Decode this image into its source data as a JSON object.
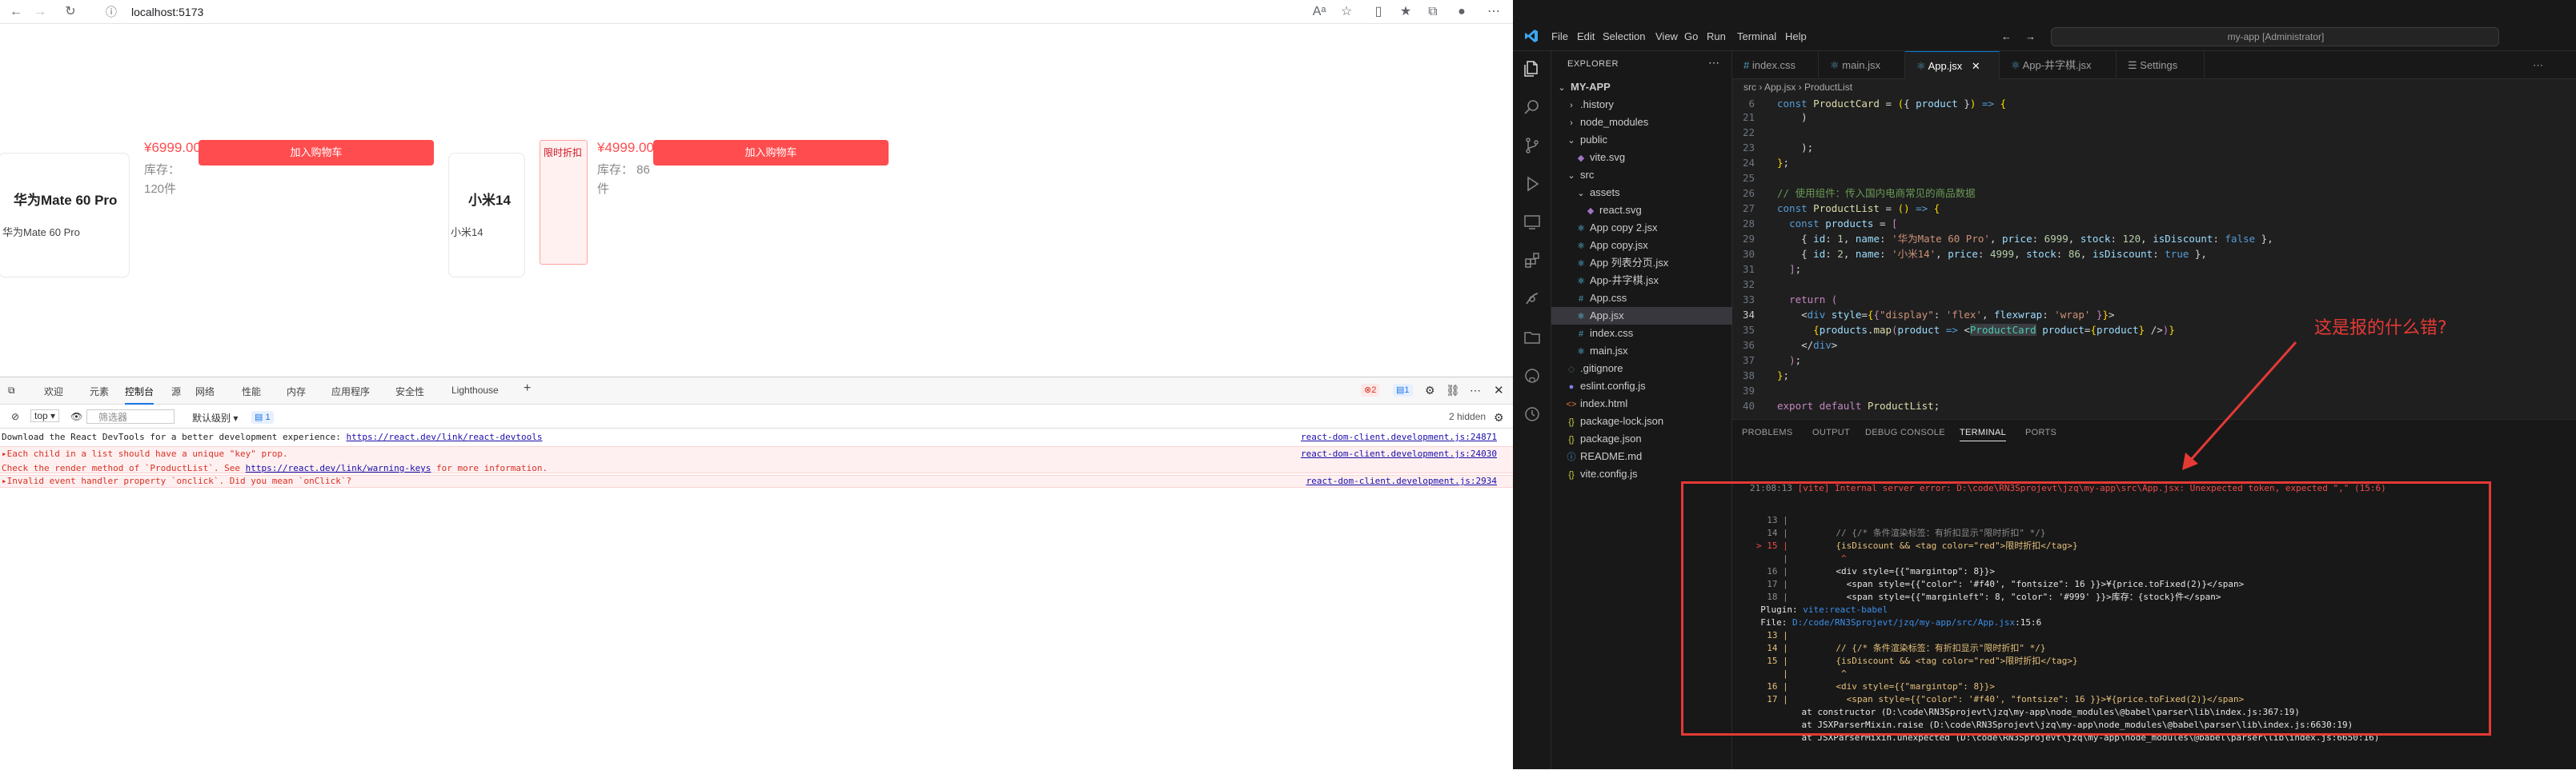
{
  "browser": {
    "url": "localhost:5173",
    "products": [
      {
        "name": "华为Mate 60 Pro",
        "img_alt": "华为Mate 60 Pro",
        "price": "¥6999.00",
        "stock": "库存：120件",
        "stock_l1": "库存：",
        "stock_l2": "120件",
        "button": "加入购物车",
        "tag": ""
      },
      {
        "name": "小米14",
        "img_alt": "小米14",
        "price": "¥4999.00",
        "stock_l1": "库存： 86",
        "stock_l2": "件",
        "button": "加入购物车",
        "tag": "限时折扣"
      }
    ]
  },
  "devtools": {
    "tabs": [
      "欢迎",
      "元素",
      "控制台",
      "源",
      "网络",
      "性能",
      "内存",
      "应用程序",
      "安全性",
      "Lighthouse"
    ],
    "active_tab": "控制台",
    "context": "top",
    "filter_placeholder": "筛选器",
    "level": "默认级别",
    "msg_badge": "1",
    "hidden": "2 hidden",
    "errors_badge": "2",
    "info_badge": "1",
    "lines": [
      {
        "type": "info",
        "text": "Download the React DevTools for a better development experience: ",
        "link": "https://react.dev/link/react-devtools",
        "src": "react-dom-client.development.js:24871"
      },
      {
        "type": "err",
        "text": "▸Each child in a list should have a unique \"key\" prop.",
        "src": "react-dom-client.development.js:24030"
      },
      {
        "type": "err",
        "text": "Check the render method of `ProductList`. See ",
        "link": "https://react.dev/link/warning-keys",
        "tail": " for more information.",
        "src": ""
      },
      {
        "type": "err",
        "text": "▸Invalid event handler property `onclick`. Did you mean `onClick`?",
        "src": "react-dom-client.development.js:2934"
      }
    ]
  },
  "vscode": {
    "menu": [
      "File",
      "Edit",
      "Selection",
      "View",
      "Go",
      "Run",
      "Terminal",
      "Help"
    ],
    "search": "my-app [Administrator]",
    "explorer_title": "EXPLORER",
    "tree": [
      {
        "label": "MY-APP",
        "indent": 0,
        "icon": "⌄",
        "bold": true
      },
      {
        "label": ".history",
        "indent": 1,
        "icon": "›"
      },
      {
        "label": "node_modules",
        "indent": 1,
        "icon": "›"
      },
      {
        "label": "public",
        "indent": 1,
        "icon": "⌄"
      },
      {
        "label": "vite.svg",
        "indent": 2,
        "icon": "◆"
      },
      {
        "label": "src",
        "indent": 1,
        "icon": "⌄"
      },
      {
        "label": "assets",
        "indent": 2,
        "icon": "⌄"
      },
      {
        "label": "react.svg",
        "indent": 3,
        "icon": "◆"
      },
      {
        "label": "App copy 2.jsx",
        "indent": 2,
        "icon": "⚛"
      },
      {
        "label": "App copy.jsx",
        "indent": 2,
        "icon": "⚛"
      },
      {
        "label": "App 列表分页.jsx",
        "indent": 2,
        "icon": "⚛"
      },
      {
        "label": "App-井字棋.jsx",
        "indent": 2,
        "icon": "⚛"
      },
      {
        "label": "App.css",
        "indent": 2,
        "icon": "#"
      },
      {
        "label": "App.jsx",
        "indent": 2,
        "icon": "⚛",
        "selected": true
      },
      {
        "label": "index.css",
        "indent": 2,
        "icon": "#"
      },
      {
        "label": "main.jsx",
        "indent": 2,
        "icon": "⚛"
      },
      {
        "label": ".gitignore",
        "indent": 1,
        "icon": "◇"
      },
      {
        "label": "eslint.config.js",
        "indent": 1,
        "icon": "●"
      },
      {
        "label": "index.html",
        "indent": 1,
        "icon": "<>"
      },
      {
        "label": "package-lock.json",
        "indent": 1,
        "icon": "{}"
      },
      {
        "label": "package.json",
        "indent": 1,
        "icon": "{}"
      },
      {
        "label": "README.md",
        "indent": 1,
        "icon": "ⓘ"
      },
      {
        "label": "vite.config.js",
        "indent": 1,
        "icon": "{}"
      }
    ],
    "tabs": [
      "index.css",
      "main.jsx",
      "App.jsx",
      "App-井字棋.jsx",
      "Settings"
    ],
    "active_tab": "App.jsx",
    "breadcrumb": "src  ›  App.jsx  ›  ProductList",
    "sticky": "const ProductCard = ({ product }) => {",
    "panel_tabs": [
      "PROBLEMS",
      "OUTPUT",
      "DEBUG CONSOLE",
      "TERMINAL",
      "PORTS"
    ],
    "active_panel_tab": "TERMINAL",
    "terminal_header": "21:08:13 [vite] Internal server error: D:\\code\\RN3Sprojevt\\jzq\\my-app\\src\\App.jsx: Unexpected token, expected \",\" (15:6)"
  },
  "annotation": {
    "question": "这是报的什么错?"
  }
}
